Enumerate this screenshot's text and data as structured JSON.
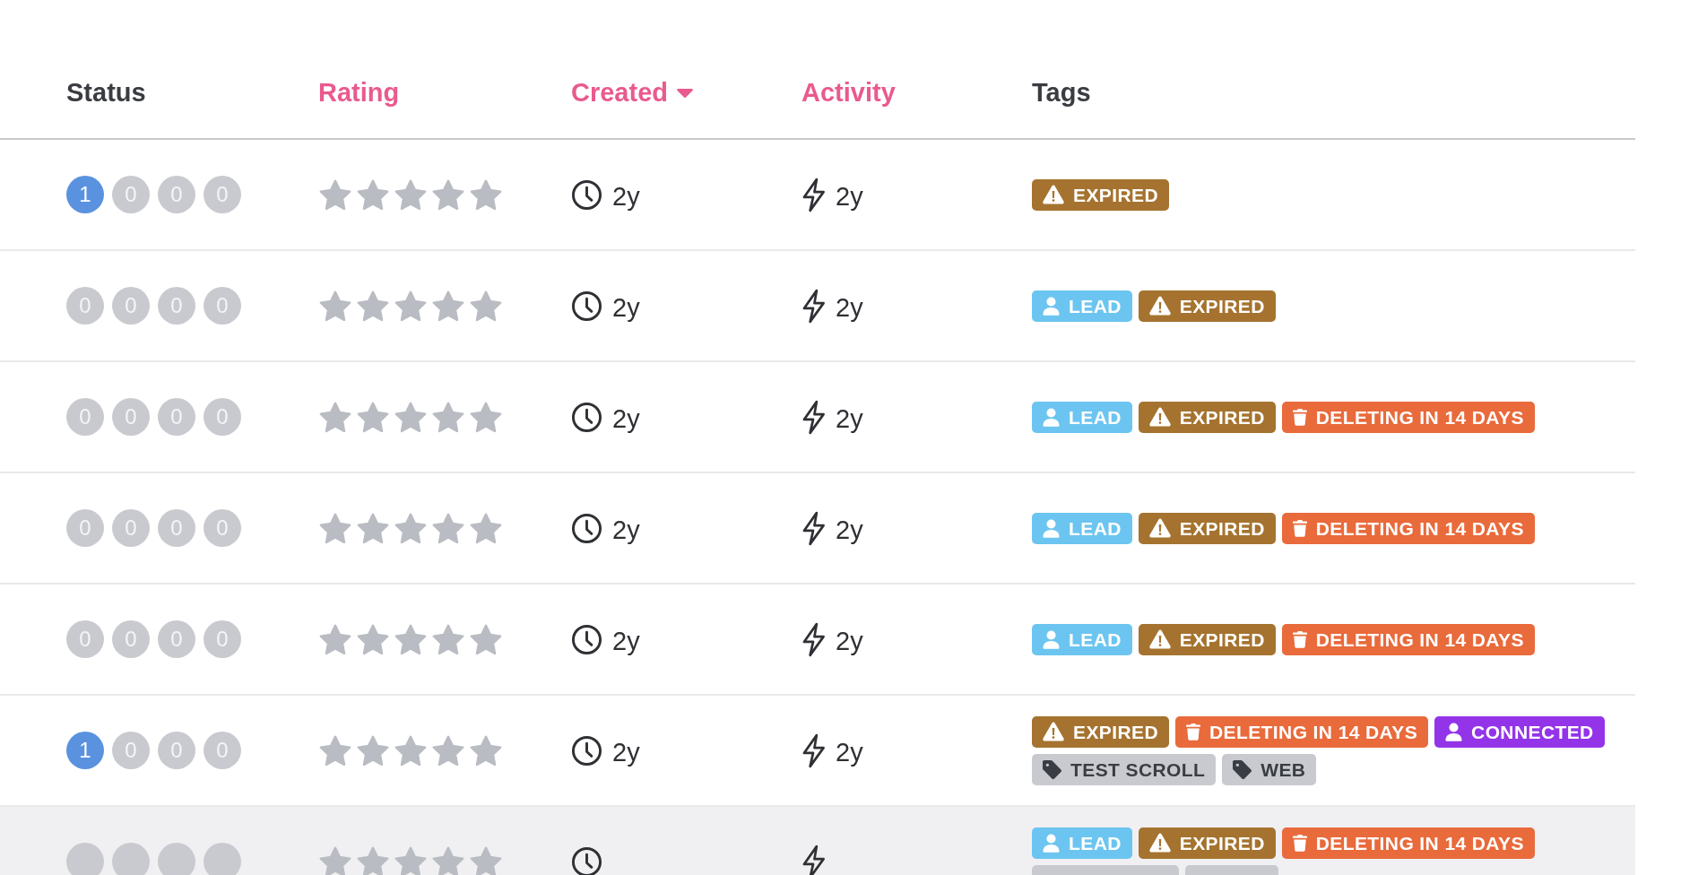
{
  "table": {
    "columns": [
      {
        "label": "Status",
        "sortable": false,
        "sorted": false
      },
      {
        "label": "Rating",
        "sortable": true,
        "sorted": false
      },
      {
        "label": "Created",
        "sortable": true,
        "sorted": true
      },
      {
        "label": "Activity",
        "sortable": true,
        "sorted": false
      },
      {
        "label": "Tags",
        "sortable": false,
        "sorted": false
      }
    ],
    "rows": [
      {
        "highlighted": false,
        "status": [
          {
            "count": "1",
            "active": true
          },
          {
            "count": "0",
            "active": false
          },
          {
            "count": "0",
            "active": false
          },
          {
            "count": "0",
            "active": false
          }
        ],
        "stars": 0,
        "created": "2y",
        "activity": "2y",
        "tags": [
          {
            "label": "EXPIRED",
            "kind": "warning",
            "color": "#a5732f"
          }
        ]
      },
      {
        "highlighted": false,
        "status": [
          {
            "count": "0",
            "active": false
          },
          {
            "count": "0",
            "active": false
          },
          {
            "count": "0",
            "active": false
          },
          {
            "count": "0",
            "active": false
          }
        ],
        "stars": 0,
        "created": "2y",
        "activity": "2y",
        "tags": [
          {
            "label": "LEAD",
            "kind": "user",
            "color": "#6cc5f0"
          },
          {
            "label": "EXPIRED",
            "kind": "warning",
            "color": "#a5732f"
          }
        ]
      },
      {
        "highlighted": false,
        "status": [
          {
            "count": "0",
            "active": false
          },
          {
            "count": "0",
            "active": false
          },
          {
            "count": "0",
            "active": false
          },
          {
            "count": "0",
            "active": false
          }
        ],
        "stars": 0,
        "created": "2y",
        "activity": "2y",
        "tags": [
          {
            "label": "LEAD",
            "kind": "user",
            "color": "#6cc5f0"
          },
          {
            "label": "EXPIRED",
            "kind": "warning",
            "color": "#a5732f"
          },
          {
            "label": "DELETING IN 14 DAYS",
            "kind": "trash",
            "color": "#e96a3b"
          }
        ]
      },
      {
        "highlighted": false,
        "status": [
          {
            "count": "0",
            "active": false
          },
          {
            "count": "0",
            "active": false
          },
          {
            "count": "0",
            "active": false
          },
          {
            "count": "0",
            "active": false
          }
        ],
        "stars": 0,
        "created": "2y",
        "activity": "2y",
        "tags": [
          {
            "label": "LEAD",
            "kind": "user",
            "color": "#6cc5f0"
          },
          {
            "label": "EXPIRED",
            "kind": "warning",
            "color": "#a5732f"
          },
          {
            "label": "DELETING IN 14 DAYS",
            "kind": "trash",
            "color": "#e96a3b"
          }
        ]
      },
      {
        "highlighted": false,
        "status": [
          {
            "count": "0",
            "active": false
          },
          {
            "count": "0",
            "active": false
          },
          {
            "count": "0",
            "active": false
          },
          {
            "count": "0",
            "active": false
          }
        ],
        "stars": 0,
        "created": "2y",
        "activity": "2y",
        "tags": [
          {
            "label": "LEAD",
            "kind": "user",
            "color": "#6cc5f0"
          },
          {
            "label": "EXPIRED",
            "kind": "warning",
            "color": "#a5732f"
          },
          {
            "label": "DELETING IN 14 DAYS",
            "kind": "trash",
            "color": "#e96a3b"
          }
        ]
      },
      {
        "highlighted": false,
        "status": [
          {
            "count": "1",
            "active": true
          },
          {
            "count": "0",
            "active": false
          },
          {
            "count": "0",
            "active": false
          },
          {
            "count": "0",
            "active": false
          }
        ],
        "stars": 0,
        "created": "2y",
        "activity": "2y",
        "tags": [
          {
            "label": "EXPIRED",
            "kind": "warning",
            "color": "#a5732f"
          },
          {
            "label": "DELETING IN 14 DAYS",
            "kind": "trash",
            "color": "#e96a3b"
          },
          {
            "label": "CONNECTED",
            "kind": "user",
            "color": "#9334e9"
          },
          {
            "label": "TEST SCROLL",
            "kind": "label",
            "color": "#c8cacf"
          },
          {
            "label": "WEB",
            "kind": "label",
            "color": "#c8cacf"
          }
        ]
      },
      {
        "highlighted": true,
        "status": [
          {
            "active": false
          },
          {
            "active": false
          },
          {
            "active": false
          },
          {
            "active": false
          }
        ],
        "stars": 0,
        "tags": [
          {
            "label": "LEAD",
            "kind": "user",
            "color": "#6cc5f0"
          },
          {
            "label": "EXPIRED",
            "kind": "warning",
            "color": "#a5732f"
          },
          {
            "label": "DELETING IN 14 DAYS",
            "kind": "trash",
            "color": "#e96a3b"
          },
          {
            "kind": "label",
            "color": "#c8cacf"
          },
          {
            "kind": "label",
            "color": "#c8cacf"
          }
        ]
      }
    ]
  }
}
